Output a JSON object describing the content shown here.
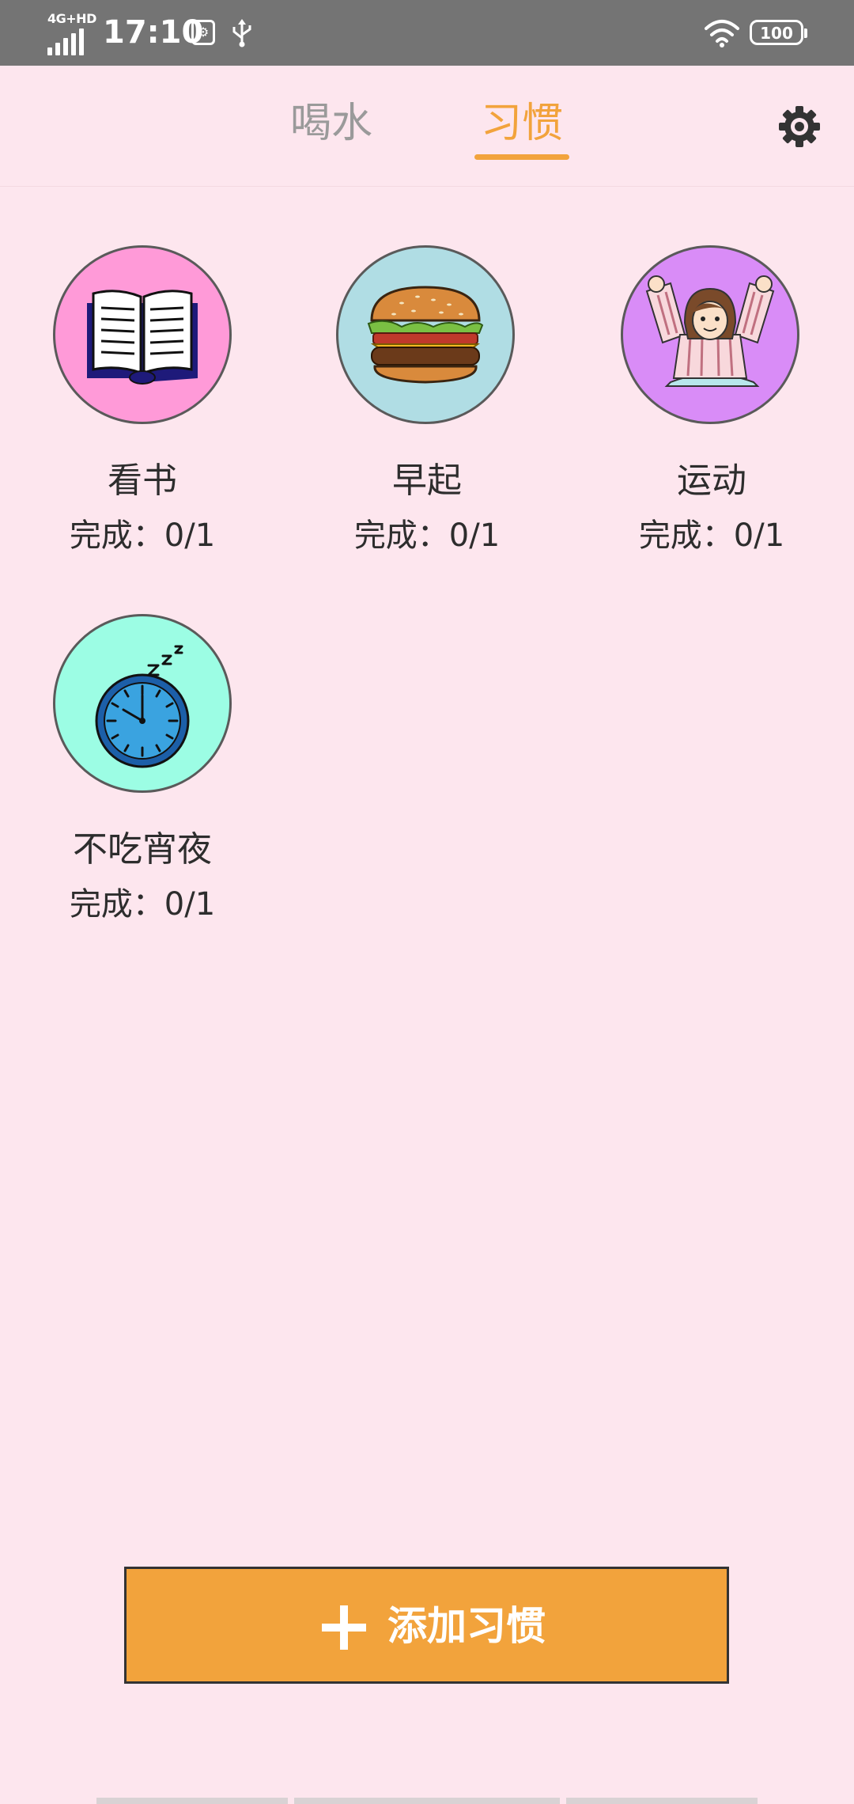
{
  "status_bar": {
    "network": "4G+HD",
    "time": "17:10",
    "battery": "100"
  },
  "tabs": [
    {
      "label": "喝水",
      "active": false
    },
    {
      "label": "习惯",
      "active": true
    }
  ],
  "accent_color": "#f2a33c",
  "habits": [
    {
      "name": "看书",
      "progress": "完成：0/1",
      "icon": "book-icon",
      "color": "#ff9ad8"
    },
    {
      "name": "早起",
      "progress": "完成：0/1",
      "icon": "burger-icon",
      "color": "#b0dde4"
    },
    {
      "name": "运动",
      "progress": "完成：0/1",
      "icon": "stretching-girl-icon",
      "color": "#d98cf7"
    },
    {
      "name": "不吃宵夜",
      "progress": "完成：0/1",
      "icon": "sleeping-clock-icon",
      "color": "#9cfde4"
    }
  ],
  "add_button": {
    "label": "添加习惯",
    "icon": "plus-icon"
  }
}
